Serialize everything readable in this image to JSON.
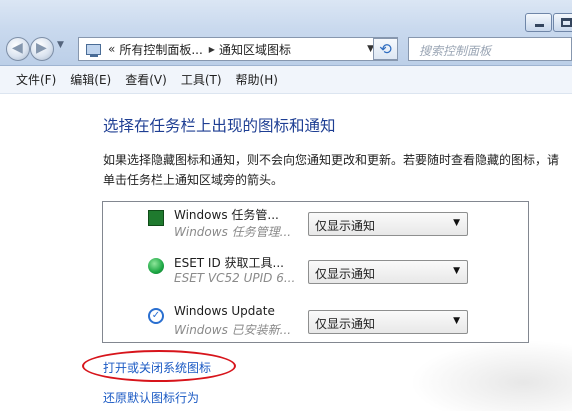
{
  "address_bar": {
    "crumbs": [
      "所有控制面板...",
      "通知区域图标"
    ],
    "search_placeholder": "搜索控制面板"
  },
  "menu": [
    "文件(F)",
    "编辑(E)",
    "查看(V)",
    "工具(T)",
    "帮助(H)"
  ],
  "main": {
    "title": "选择在任务栏上出现的图标和通知",
    "description": "如果选择隐藏图标和通知，则不会向您通知更改和更新。若要随时查看隐藏的图标，请单击任务栏上通知区域旁的箭头。"
  },
  "icons_list": [
    {
      "name": "Windows 任务管...",
      "desc": "Windows 任务管理...",
      "behavior": "仅显示通知",
      "icon": "task-manager-icon"
    },
    {
      "name": "ESET ID 获取工具...",
      "desc": "ESET VC52 UPID 6...",
      "behavior": "仅显示通知",
      "icon": "eset-icon"
    },
    {
      "name": "Windows Update",
      "desc": "Windows 已安装新...",
      "behavior": "仅显示通知",
      "icon": "windows-update-icon"
    }
  ],
  "links": {
    "system_icons": "打开或关闭系统图标",
    "restore_default": "还原默认图标行为"
  },
  "colors": {
    "title": "#1e3e93",
    "link": "#1b5ac4",
    "highlight": "#d7141b"
  }
}
